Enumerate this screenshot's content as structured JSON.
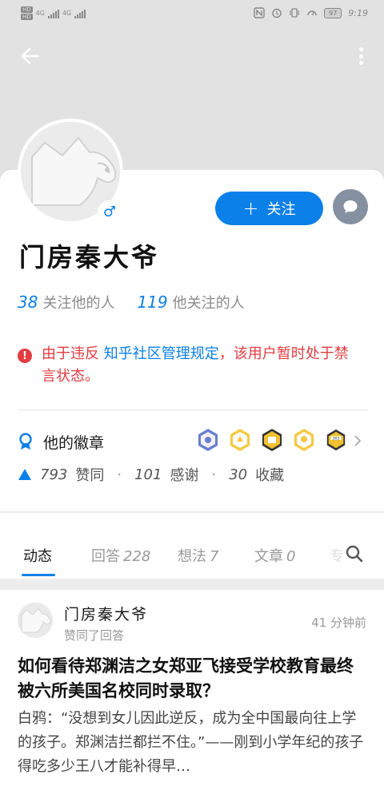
{
  "status_bar": {
    "sim1": "HD",
    "sim2": "HD",
    "net1": "4G",
    "net2": "4G",
    "battery": "97",
    "time": "9:19"
  },
  "profile": {
    "name": "门房秦大爷",
    "gender_symbol": "♂",
    "follow_button": "关注",
    "follow_plus": "+",
    "followers_count": "38",
    "followers_label": "关注他的人",
    "following_count": "119",
    "following_label": "他关注的人",
    "notice_icon": "!",
    "notice_prefix": "由于违反 ",
    "notice_link": "知乎社区管理规定",
    "notice_suffix": "，该用户暂时处于禁言状态。",
    "badges_label": "他的徽章",
    "badges": [
      {
        "icon": "badge-blue-icon",
        "color": "#6a7fd0"
      },
      {
        "icon": "badge-gold-icon",
        "color": "#f5c842"
      },
      {
        "icon": "badge-gold-dark-icon",
        "color": "#f0c030"
      },
      {
        "icon": "badge-gold-icon",
        "color": "#f5c842"
      },
      {
        "icon": "badge-365-icon",
        "color": "#f0c030",
        "text": "365"
      }
    ],
    "upvotes_count": "793",
    "upvotes_label": "赞同",
    "thanks_count": "101",
    "thanks_label": "感谢",
    "favorites_count": "30",
    "favorites_label": "收藏",
    "sep": "·"
  },
  "tabs": [
    {
      "label": "动态",
      "count": ""
    },
    {
      "label": "回答",
      "count": "228"
    },
    {
      "label": "想法",
      "count": "7"
    },
    {
      "label": "文章",
      "count": "0"
    },
    {
      "label": "专",
      "count": ""
    }
  ],
  "feed": {
    "author": "门房秦大爷",
    "action": "赞同了回答",
    "time": "41 分钟前",
    "title": "如何看待郑渊洁之女郑亚飞接受学校教育最终被六所美国名校同时录取？",
    "excerpt": "白鸦：“没想到女儿因此逆反，成为全中国最向往上学的孩子。郑渊洁拦都拦不住。”——刚到小学年纪的孩子得吃多少王八才能补得早…"
  },
  "colors": {
    "accent": "#0b80e8",
    "warning": "#e23c41",
    "header_bg": "#e2e2e2"
  }
}
